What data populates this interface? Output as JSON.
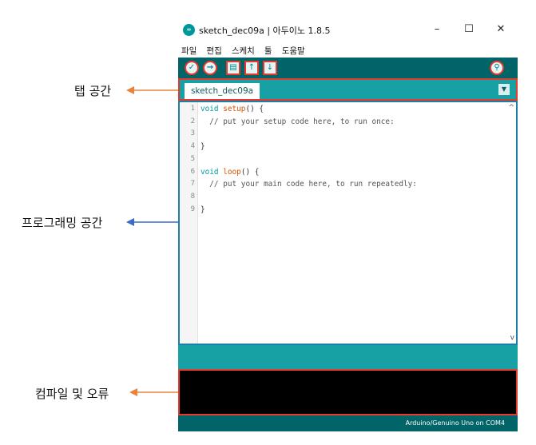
{
  "annotations": {
    "tab_area": "탭 공간",
    "programming_area": "프로그래밍 공간",
    "compile_errors": "컴파일 및 오류"
  },
  "window": {
    "title": "sketch_dec09a | 아두이노 1.8.5",
    "logo": "∞",
    "minimize": "–",
    "maximize": "☐",
    "close": "✕"
  },
  "menu": [
    "파일",
    "편집",
    "스케치",
    "툴",
    "도움말"
  ],
  "toolbar": {
    "verify": "✓",
    "upload": "→",
    "new": "▤",
    "open": "↑",
    "save": "↓",
    "serial_monitor": "⚲"
  },
  "tab": {
    "name": "sketch_dec09a",
    "menu_icon": "▼"
  },
  "code": {
    "line_numbers": [
      "1",
      "2",
      "3",
      "4",
      "5",
      "6",
      "7",
      "8",
      "9"
    ],
    "lines": [
      {
        "keyword": "void",
        "func": "setup",
        "rest": "() {"
      },
      {
        "comment": "  // put your setup code here, to run once:"
      },
      {
        "text": ""
      },
      {
        "text": "}"
      },
      {
        "text": ""
      },
      {
        "keyword": "void",
        "func": "loop",
        "rest": "() {"
      },
      {
        "comment": "  // put your main code here, to run repeatedly:"
      },
      {
        "text": ""
      },
      {
        "text": "}"
      }
    ],
    "scroll_up": "^",
    "scroll_down": "v"
  },
  "status": {
    "board": "Arduino/Genuino Uno on COM4"
  },
  "colors": {
    "teal_dark": "#006468",
    "teal": "#17a1a5",
    "highlight_red": "#e33b2d",
    "editor_border": "#1e7fa6",
    "arrow_orange": "#e8833a",
    "arrow_blue": "#3a6bc9"
  }
}
